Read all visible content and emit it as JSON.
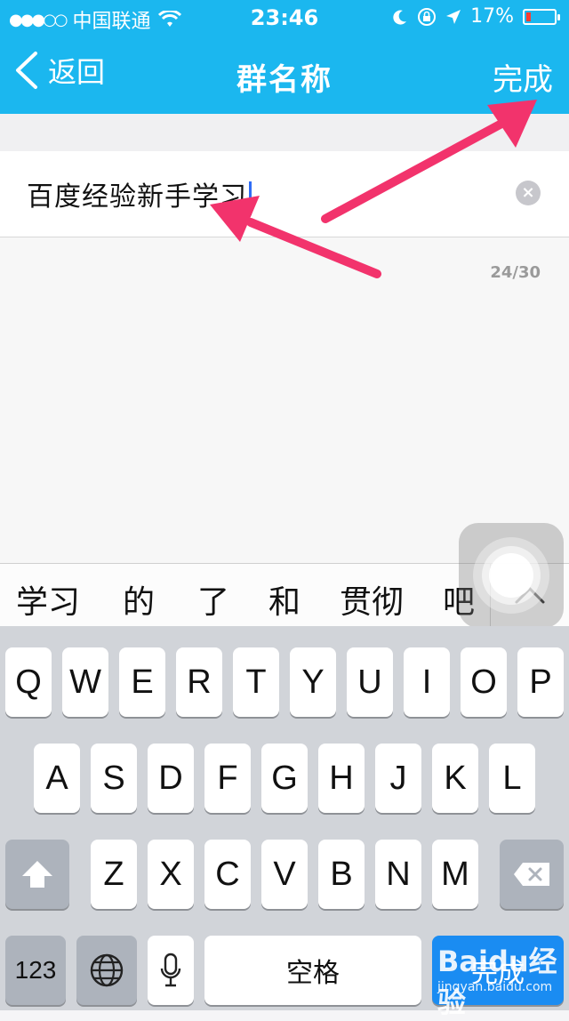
{
  "status_bar": {
    "signal": "●●●○○",
    "carrier": "中国联通",
    "time": "23:46",
    "battery_percent": "17%",
    "battery_level": 0.17,
    "battery_color": "#ff3b30"
  },
  "nav": {
    "back_label": "返回",
    "title": "群名称",
    "done_label": "完成"
  },
  "form": {
    "group_name_value": "百度经验新手学习",
    "char_count": "24/30"
  },
  "candidates": [
    "学习",
    "的",
    "了",
    "和",
    "贯彻",
    "吧"
  ],
  "keyboard": {
    "row1": [
      "Q",
      "W",
      "E",
      "R",
      "T",
      "Y",
      "U",
      "I",
      "O",
      "P"
    ],
    "row2": [
      "A",
      "S",
      "D",
      "F",
      "G",
      "H",
      "J",
      "K",
      "L"
    ],
    "row3": [
      "Z",
      "X",
      "C",
      "V",
      "B",
      "N",
      "M"
    ],
    "numbers_label": "123",
    "space_label": "空格",
    "return_label": "完成"
  },
  "watermark": {
    "brand": "Baidu经验",
    "url": "jingyan.baidu.com"
  },
  "colors": {
    "nav_bg": "#1bb7ef",
    "arrow": "#f2336c",
    "return_key": "#1a8cf2"
  },
  "icons": [
    "wifi-icon",
    "moon-icon",
    "rotation-lock-icon",
    "location-icon",
    "battery-icon",
    "back-chevron-icon",
    "clear-icon",
    "expand-chevron-icon",
    "shift-icon",
    "delete-icon",
    "globe-icon",
    "microphone-icon"
  ]
}
